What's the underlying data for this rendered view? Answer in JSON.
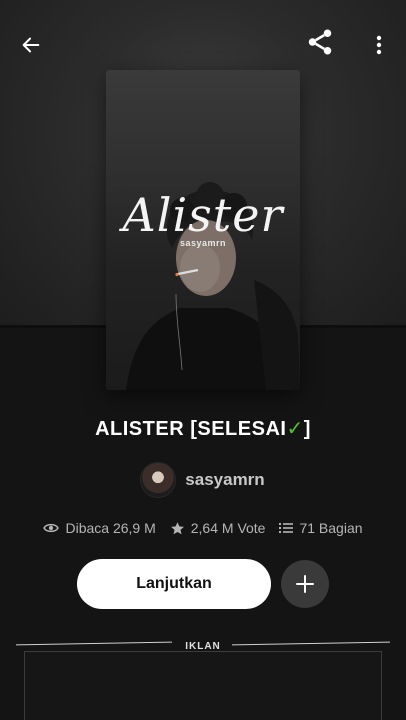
{
  "cover": {
    "title": "Alister",
    "author": "sasyamrn"
  },
  "book": {
    "title": "ALISTER [SELESAI",
    "title_check": "✓",
    "title_end": "]"
  },
  "author": {
    "name": "sasyamrn"
  },
  "stats": {
    "reads": "Dibaca 26,9 M",
    "votes": "2,64 M Vote",
    "parts": "71 Bagian"
  },
  "actions": {
    "continue_label": "Lanjutkan",
    "add_label": "+"
  },
  "ad": {
    "label": "IKLAN"
  },
  "colors": {
    "check": "#55c234",
    "background": "#141414",
    "button_primary": "#ffffff",
    "button_secondary": "#3a3a3a"
  }
}
